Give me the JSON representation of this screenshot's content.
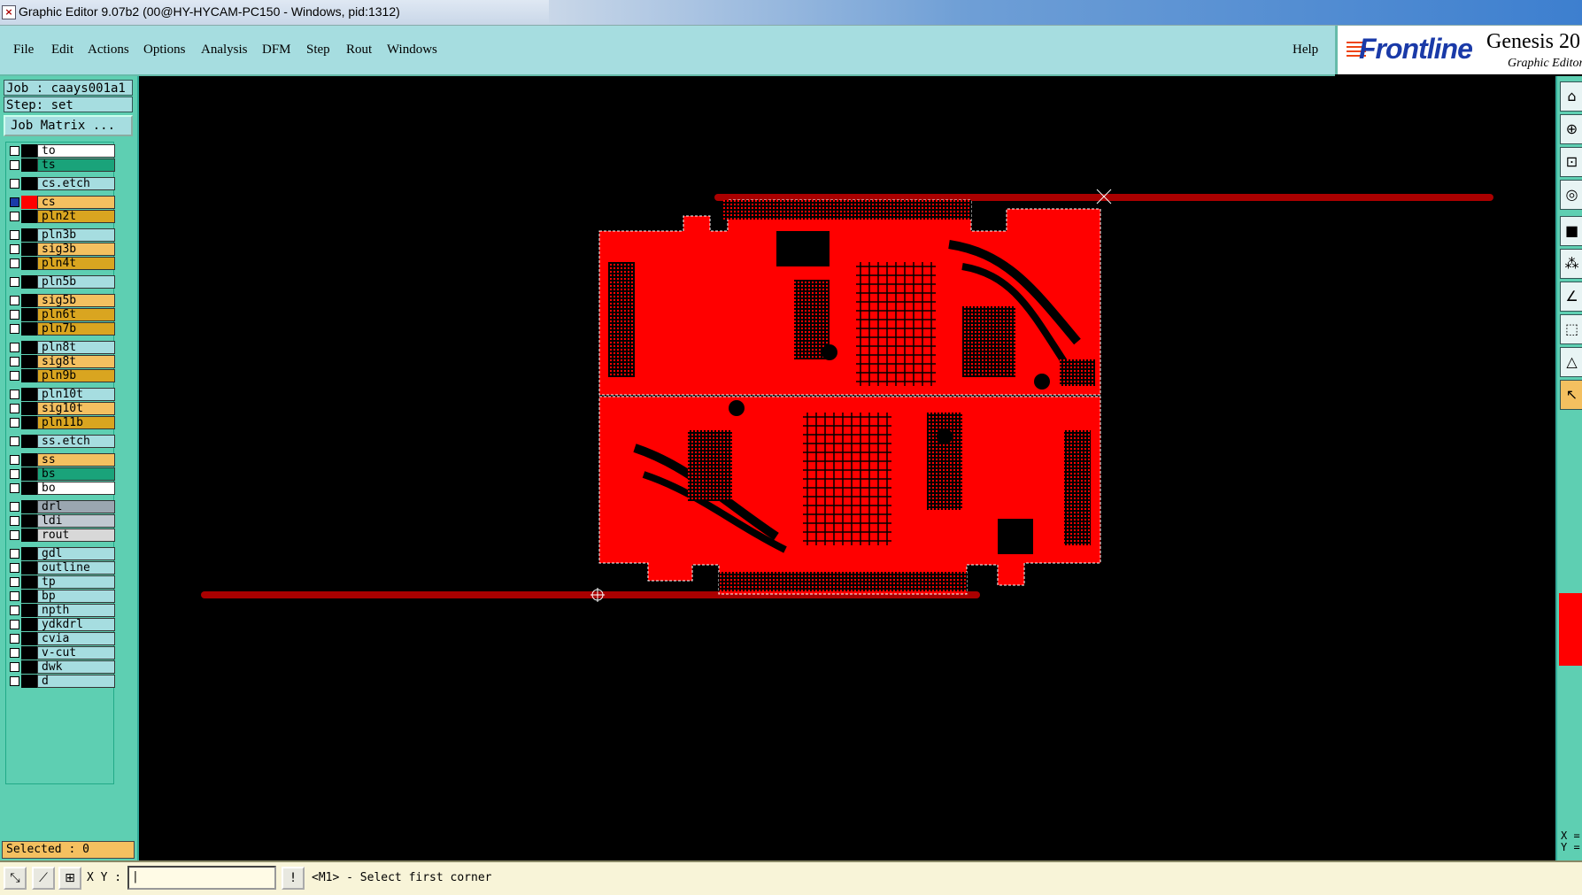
{
  "window": {
    "title": "Graphic Editor 9.07b2 (00@HY-HYCAM-PC150 - Windows, pid:1312)"
  },
  "menu": {
    "items": [
      "File",
      "Edit",
      "Actions",
      "Options",
      "Analysis",
      "DFM",
      "Step",
      "Rout",
      "Windows"
    ],
    "help": "Help"
  },
  "logo": {
    "brand": "Frontline",
    "product": "Genesis 20",
    "subtitle": "Graphic Editor"
  },
  "job": {
    "job_label": "Job : caays001a1",
    "step_label": "Step: set",
    "matrix_button": "Job Matrix ..."
  },
  "layers": [
    {
      "name": "to",
      "color": "#ffffff"
    },
    {
      "name": "ts",
      "color": "#1aa37a"
    },
    {
      "name": "cs.etch",
      "color": "#a6dde0"
    },
    {
      "name": "cs",
      "color": "#f4c060",
      "active": true
    },
    {
      "name": "pln2t",
      "color": "#d9a520"
    },
    {
      "name": "pln3b",
      "color": "#a6dde0"
    },
    {
      "name": "sig3b",
      "color": "#f4c060"
    },
    {
      "name": "pln4t",
      "color": "#d9a520"
    },
    {
      "name": "pln5b",
      "color": "#a6dde0"
    },
    {
      "name": "sig5b",
      "color": "#f4c060"
    },
    {
      "name": "pln6t",
      "color": "#d9a520"
    },
    {
      "name": "pln7b",
      "color": "#d9a520"
    },
    {
      "name": "pln8t",
      "color": "#a6dde0"
    },
    {
      "name": "sig8t",
      "color": "#f4c060"
    },
    {
      "name": "pln9b",
      "color": "#d9a520"
    },
    {
      "name": "pln10t",
      "color": "#a6dde0"
    },
    {
      "name": "sig10t",
      "color": "#f4c060"
    },
    {
      "name": "pln11b",
      "color": "#d9a520"
    },
    {
      "name": "ss.etch",
      "color": "#a6dde0"
    },
    {
      "name": "ss",
      "color": "#f4c060"
    },
    {
      "name": "bs",
      "color": "#1aa37a"
    },
    {
      "name": "bo",
      "color": "#ffffff"
    },
    {
      "name": "drl",
      "color": "#9aa6b0"
    },
    {
      "name": "ldi",
      "color": "#c0c8d0"
    },
    {
      "name": "rout",
      "color": "#d8d8d8"
    },
    {
      "name": "gdl",
      "color": "#a6dde0"
    },
    {
      "name": "outline",
      "color": "#a6dde0"
    },
    {
      "name": "tp",
      "color": "#a6dde0"
    },
    {
      "name": "bp",
      "color": "#a6dde0"
    },
    {
      "name": "npth",
      "color": "#a6dde0"
    },
    {
      "name": "ydkdrl",
      "color": "#a6dde0"
    },
    {
      "name": "cvia",
      "color": "#a6dde0"
    },
    {
      "name": "v-cut",
      "color": "#a6dde0"
    },
    {
      "name": "dwk",
      "color": "#a6dde0"
    },
    {
      "name": "d",
      "color": "#a6dde0"
    }
  ],
  "status": {
    "selected": "Selected : 0",
    "xy_label": "X Y :",
    "prompt": "<M1> - Select first corner",
    "x_read": "X =",
    "y_read": "Y ="
  },
  "colors": {
    "board": "#ff0000",
    "background": "#000000",
    "panel": "#5ecfb2",
    "menu": "#a6dde0"
  }
}
